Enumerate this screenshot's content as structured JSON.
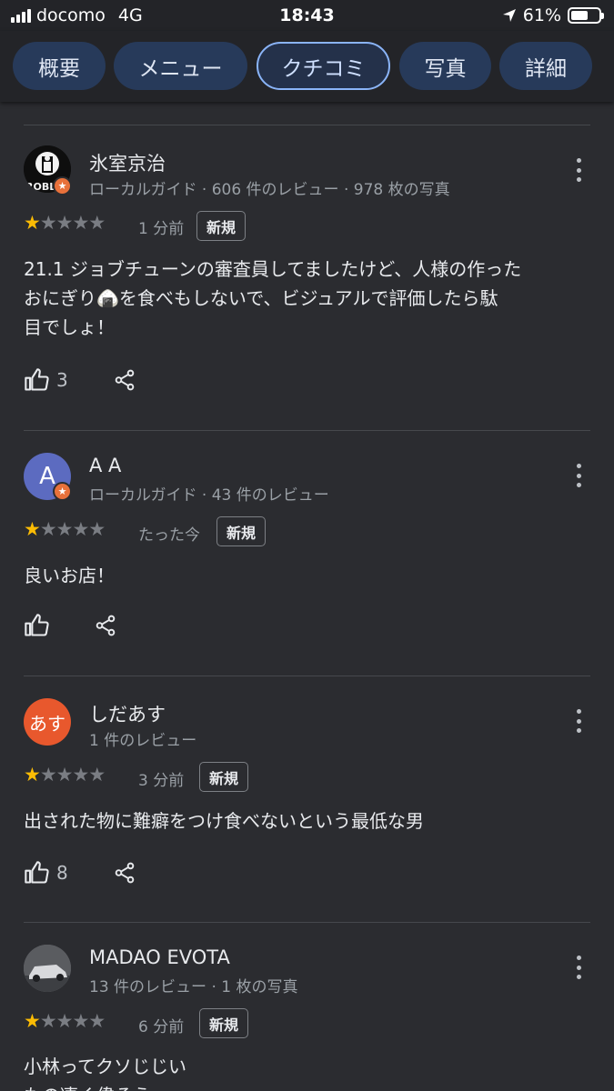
{
  "status_bar": {
    "carrier": "docomo",
    "network": "4G",
    "time": "18:43",
    "battery": "61%",
    "battery_level": 0.61
  },
  "tabs": [
    {
      "label": "概要",
      "active": false
    },
    {
      "label": "メニュー",
      "active": false
    },
    {
      "label": "クチコミ",
      "active": true
    },
    {
      "label": "写真",
      "active": false
    },
    {
      "label": "詳細",
      "active": false
    }
  ],
  "reviews": [
    {
      "name": "氷室京治",
      "meta": "ローカルガイド · 606 件のレビュー · 978 枚の写真",
      "rating": 1,
      "time": "1 分前",
      "badge": "新規",
      "text_lines": [
        "21.1 ジョブチューンの審査員してましたけど、人様の作った",
        "おにぎり🍙を食べもしないで、ビジュアルで評価したら駄",
        "目でしょ！"
      ],
      "likes": "3",
      "avatar_text": "ROBLO",
      "local_guide": true
    },
    {
      "name": "A A",
      "meta": "ローカルガイド · 43 件のレビュー",
      "rating": 1,
      "time": "たった今",
      "badge": "新規",
      "text_lines": [
        "良いお店！"
      ],
      "likes": "",
      "avatar_text": "A",
      "local_guide": true
    },
    {
      "name": "しだあす",
      "meta": "1 件のレビュー",
      "rating": 1,
      "time": "3 分前",
      "badge": "新規",
      "text_lines": [
        "出された物に難癖をつけ食べないという最低な男"
      ],
      "likes": "8",
      "avatar_text": "あす",
      "local_guide": false
    },
    {
      "name": "MADAO EVOTA",
      "meta": "13 件のレビュー · 1 枚の写真",
      "rating": 1,
      "time": "6 分前",
      "badge": "新規",
      "text_lines": [
        "小林ってクソじじい",
        "もの凄く偉そう"
      ],
      "likes": "",
      "avatar_text": "",
      "local_guide": false
    }
  ],
  "colors": {
    "background": "#2b2c30",
    "star_filled": "#fbbc04",
    "star_empty": "#7a7d83",
    "tab_active_border": "#8ab4f8",
    "guide_badge": "#e8713b"
  }
}
